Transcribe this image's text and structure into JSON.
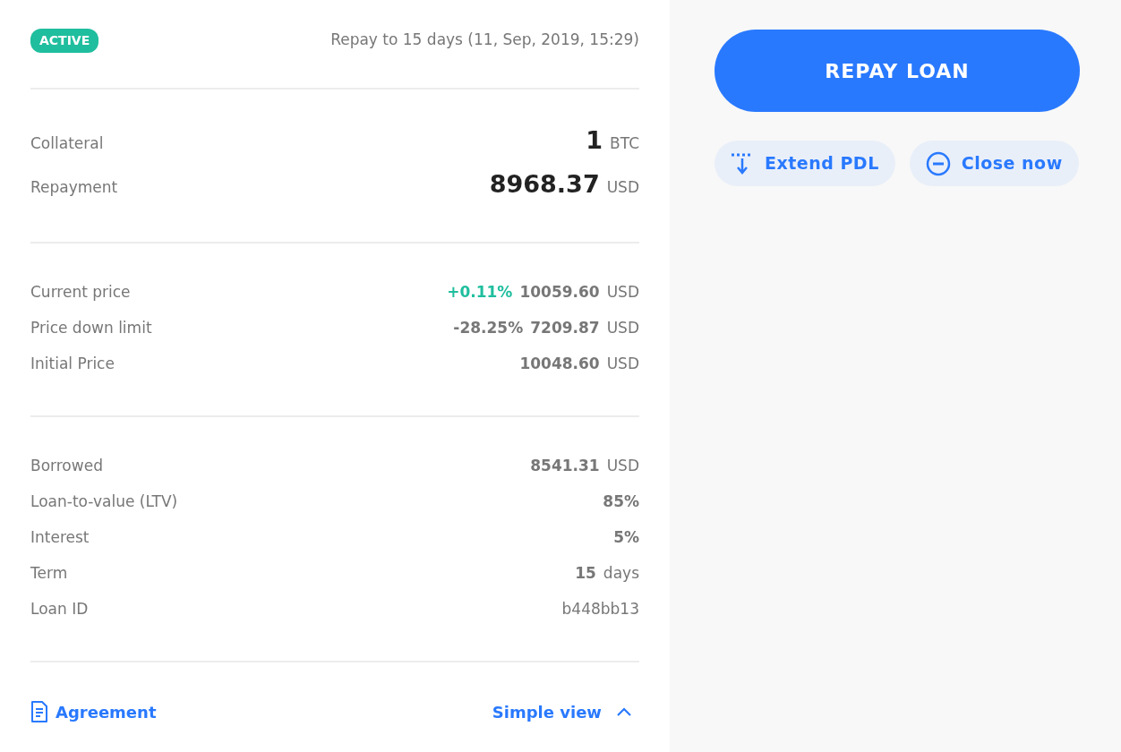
{
  "status_badge": "ACTIVE",
  "due_text": "Repay to 15 days (11, Sep, 2019, 15:29)",
  "sections": [
    {
      "kind": "headline",
      "rows": [
        {
          "label": "Collateral",
          "parts": [
            {
              "kind": "amount",
              "text": "1"
            },
            {
              "kind": "unit",
              "text": "BTC"
            }
          ]
        },
        {
          "label": "Repayment",
          "parts": [
            {
              "kind": "amount",
              "text": "8968.37"
            },
            {
              "kind": "unit",
              "text": "USD"
            }
          ]
        }
      ]
    },
    {
      "kind": "detail",
      "rows": [
        {
          "label": "Current price",
          "parts": [
            {
              "kind": "gain",
              "text": "+0.11%"
            },
            {
              "kind": "amount",
              "text": "10059.60"
            },
            {
              "kind": "unit",
              "text": "USD"
            }
          ]
        },
        {
          "label": "Price down limit",
          "parts": [
            {
              "kind": "amount",
              "text": "-28.25%"
            },
            {
              "kind": "amount",
              "text": "7209.87"
            },
            {
              "kind": "unit",
              "text": "USD"
            }
          ]
        },
        {
          "label": "Initial Price",
          "parts": [
            {
              "kind": "amount",
              "text": "10048.60"
            },
            {
              "kind": "unit",
              "text": "USD"
            }
          ]
        }
      ]
    },
    {
      "kind": "detail",
      "rows": [
        {
          "label": "Borrowed",
          "parts": [
            {
              "kind": "amount",
              "text": "8541.31"
            },
            {
              "kind": "unit",
              "text": "USD"
            }
          ]
        },
        {
          "label": "Loan-to-value (LTV)",
          "parts": [
            {
              "kind": "amount",
              "text": "85%"
            }
          ]
        },
        {
          "label": "Interest",
          "parts": [
            {
              "kind": "amount",
              "text": "5%"
            }
          ]
        },
        {
          "label": "Term",
          "parts": [
            {
              "kind": "amount",
              "text": "15"
            },
            {
              "kind": "unit",
              "text": "days"
            }
          ]
        },
        {
          "label": "Loan ID",
          "parts": [
            {
              "kind": "unit",
              "text": "b448bb13"
            }
          ]
        }
      ]
    }
  ],
  "footer": {
    "agreement_link": "Agreement",
    "view_toggle": "Simple view",
    "expanded": true
  },
  "primary_button": "REPAY LOAN",
  "secondary_buttons": [
    {
      "kind": "extend",
      "label": "Extend PDL"
    },
    {
      "kind": "close",
      "label": "Close now"
    }
  ]
}
